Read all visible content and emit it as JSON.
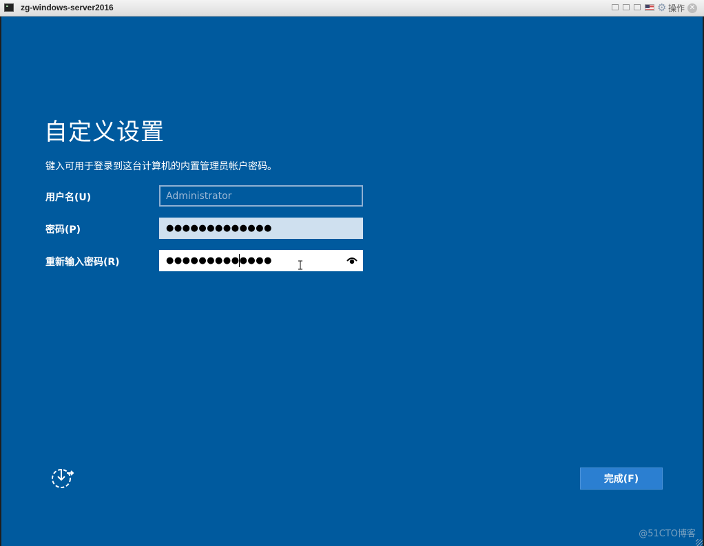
{
  "window": {
    "title": "zg-windows-server2016",
    "action_label": "操作",
    "icons": [
      "vm-console-icon",
      "restore-icon",
      "minimize-icon",
      "fullscreen-icon",
      "keyboard-flag-icon",
      "gear-icon",
      "close-icon"
    ]
  },
  "setup": {
    "title": "自定义设置",
    "instruction": "键入可用于登录到这台计算机的内置管理员帐户密码。",
    "fields": {
      "username": {
        "label": "用户名(U)",
        "value": "",
        "placeholder": "Administrator"
      },
      "password": {
        "label": "密码(P)",
        "masked_value": "●●●●●●●●●●●●●"
      },
      "confirm_password": {
        "label": "重新输入密码(R)",
        "masked_value": "●●●●●●●●●●●●●"
      }
    },
    "finish_button": "完成(F)",
    "icons": [
      "accessibility-icon",
      "reveal-password-icon"
    ]
  },
  "watermark": "@51CTO博客",
  "colors": {
    "screen_background": "#005a9e",
    "button_background": "#2b7fd1",
    "titlebar_background": "#dcdcdc"
  }
}
